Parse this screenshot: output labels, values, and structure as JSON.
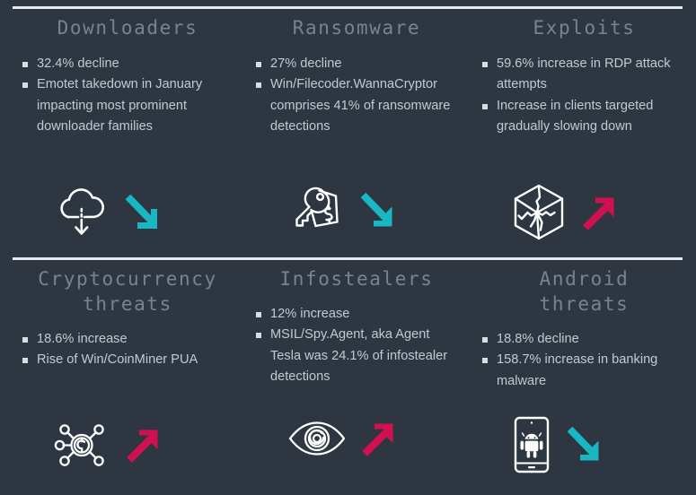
{
  "theme": {
    "background": "#2e3741",
    "divider": "#e9ecef",
    "title_color": "#79838f",
    "body_color": "#c3c9d0",
    "arrow_down_color": "#19b6c4",
    "arrow_up_color": "#d1104f",
    "icon_stroke": "#ffffff"
  },
  "rows": [
    {
      "cards": [
        {
          "title": "Downloaders",
          "bullets": [
            "32.4% decline",
            "Emotet takedown in January impacting most prominent downloader families"
          ],
          "icon": "cloud-download-icon",
          "trend": "down",
          "trend_label": "decreasing-trend-arrow"
        },
        {
          "title": "Ransomware",
          "bullets": [
            "27% decline",
            "Win/Filecoder.WannaCryptor comprises 41% of ransomware detections"
          ],
          "icon": "key-price-tag-icon",
          "trend": "down",
          "trend_label": "decreasing-trend-arrow"
        },
        {
          "title": "Exploits",
          "bullets": [
            "59.6% increase in RDP attack attempts",
            "Increase in clients targeted gradually slowing down"
          ],
          "icon": "cracked-cube-icon",
          "trend": "up",
          "trend_label": "increasing-trend-arrow"
        }
      ]
    },
    {
      "cards": [
        {
          "title": "Cryptocurrency\nthreats",
          "bullets": [
            "18.6% increase",
            "Rise of Win/CoinMiner PUA"
          ],
          "icon": "crypto-network-coin-icon",
          "trend": "up",
          "trend_label": "increasing-trend-arrow"
        },
        {
          "title": "Infostealers",
          "bullets": [
            "12% increase",
            "MSIL/Spy.Agent, aka Agent Tesla was 24.1% of infostealer detections"
          ],
          "icon": "eye-spy-icon",
          "trend": "up",
          "trend_label": "increasing-trend-arrow"
        },
        {
          "title": "Android\nthreats",
          "bullets": [
            "18.8% decline",
            "158.7% increase in banking malware"
          ],
          "icon": "android-phone-icon",
          "trend": "down",
          "trend_label": "decreasing-trend-arrow"
        }
      ]
    }
  ]
}
